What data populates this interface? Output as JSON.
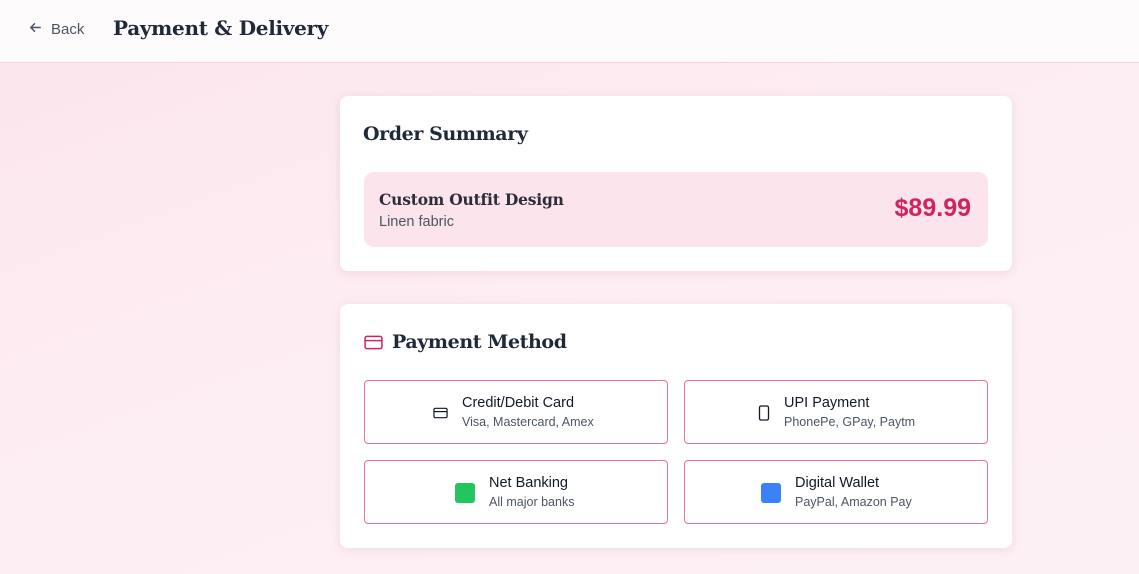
{
  "header": {
    "back_label": "Back",
    "title": "Payment & Delivery"
  },
  "order_summary": {
    "heading": "Order Summary",
    "item": {
      "name": "Custom Outfit Design",
      "fabric": "Linen fabric",
      "price": "$89.99"
    }
  },
  "payment": {
    "heading": "Payment Method",
    "options": [
      {
        "title": "Credit/Debit Card",
        "subtitle": "Visa, Mastercard, Amex",
        "icon": "credit-card-icon"
      },
      {
        "title": "UPI Payment",
        "subtitle": "PhonePe, GPay, Paytm",
        "icon": "smartphone-icon"
      },
      {
        "title": "Net Banking",
        "subtitle": "All major banks",
        "icon": "green-square-icon",
        "color": "#22c55e"
      },
      {
        "title": "Digital Wallet",
        "subtitle": "PayPal, Amazon Pay",
        "icon": "blue-square-icon",
        "color": "#3b82f6"
      }
    ]
  },
  "colors": {
    "accent": "#d0245e",
    "option_border": "#e5739a",
    "summary_bg": "#fce4ec"
  }
}
